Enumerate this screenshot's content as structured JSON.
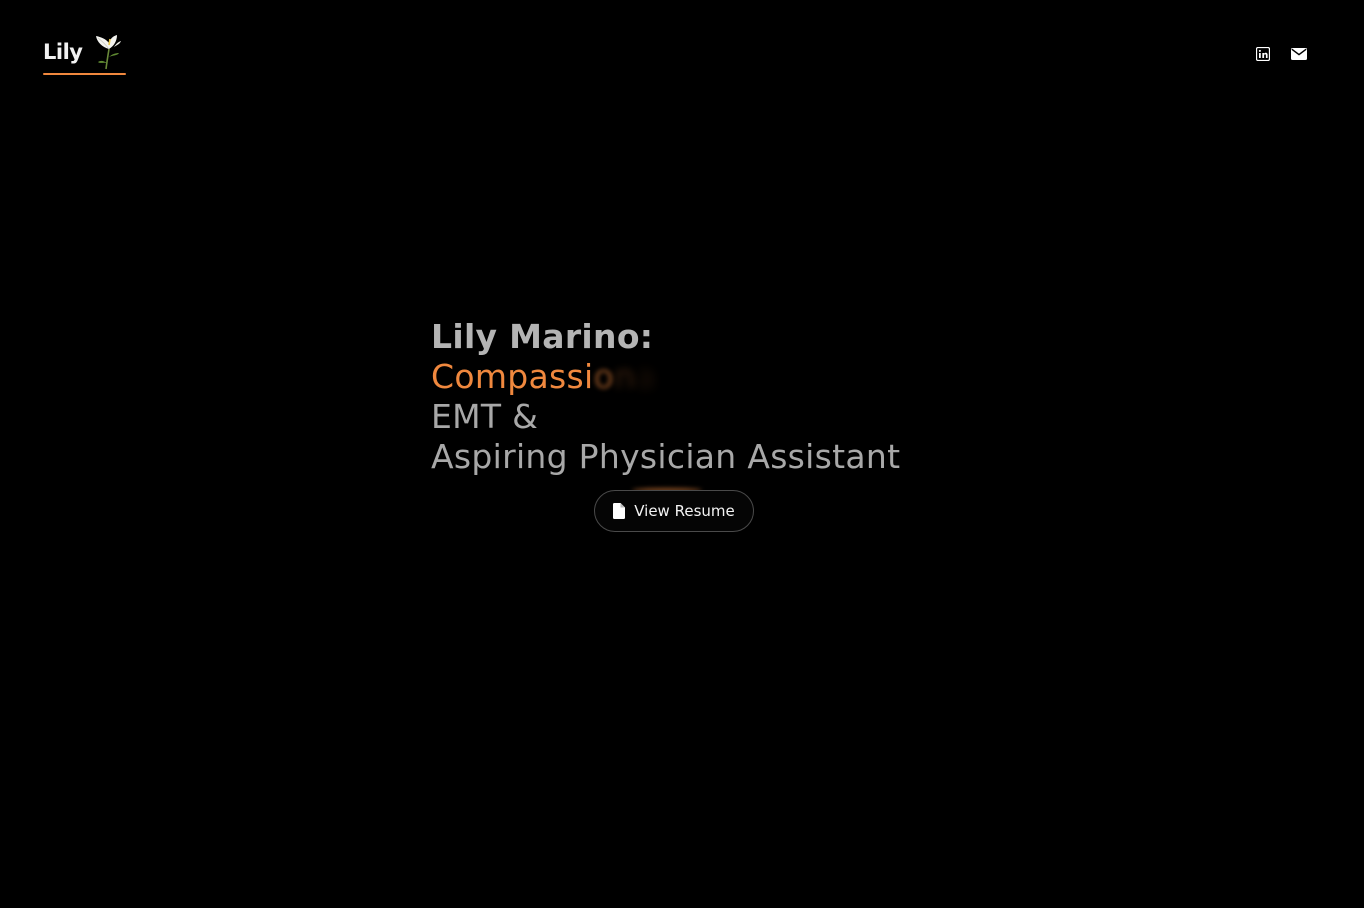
{
  "header": {
    "logo_text": "Lily",
    "logo_icon": "calla-lily-icon",
    "social": [
      {
        "name": "LinkedIn",
        "icon": "linkedin-icon"
      },
      {
        "name": "Email",
        "icon": "mail-icon"
      }
    ]
  },
  "hero": {
    "name_line": "Lily Marino:",
    "trait_typed": "Compassi",
    "trait_fading_1": "o",
    "trait_fading_2": "n",
    "trait_fading_3": "a",
    "role_line_1": "EMT &",
    "role_line_2": "Aspiring Physician Assistant"
  },
  "resume_button": {
    "label": "View Resume",
    "icon": "file-icon"
  },
  "colors": {
    "background": "#000000",
    "accent": "#f0883e",
    "heading": "#b4b4b4",
    "subtext": "#a8a8a8",
    "button_border": "#4a4a4a"
  }
}
